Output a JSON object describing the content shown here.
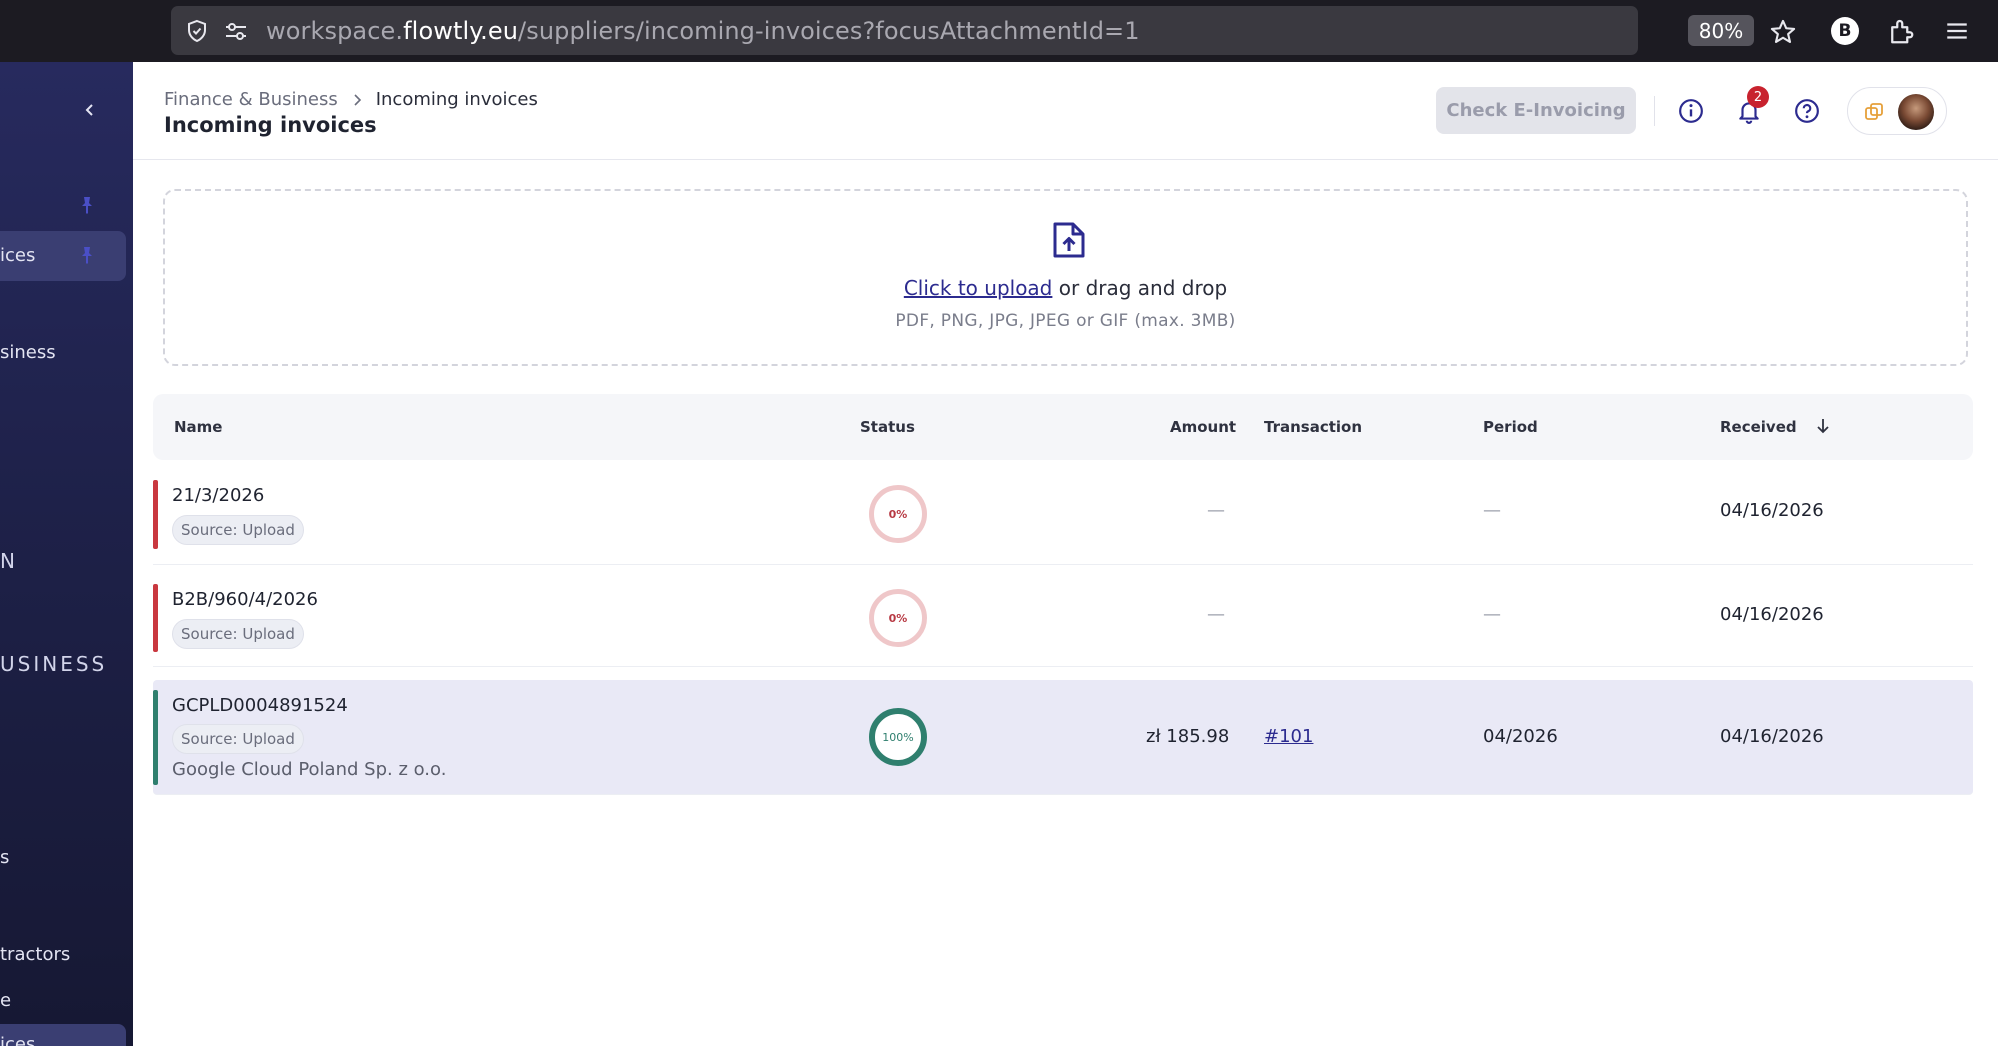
{
  "browser": {
    "url_prefix": "workspace.",
    "url_domain": "flowtly.eu",
    "url_path": "/suppliers/incoming-invoices?focusAttachmentId=1",
    "zoom": "80%",
    "profile_initial": "B"
  },
  "sidebar": {
    "items": [
      {
        "label": "ices"
      },
      {
        "label": "siness"
      },
      {
        "label": "N"
      },
      {
        "label": "USINESS"
      },
      {
        "label": "s"
      },
      {
        "label": "tractors"
      },
      {
        "label": "e"
      },
      {
        "label": "ices"
      }
    ]
  },
  "header": {
    "breadcrumb_parent": "Finance & Business",
    "breadcrumb_current": "Incoming invoices",
    "title": "Incoming invoices",
    "check_button": "Check E-Invoicing",
    "notification_count": "2"
  },
  "upload": {
    "link_text": "Click to upload",
    "rest_text": " or drag and drop",
    "hint": "PDF, PNG, JPG, JPEG or GIF (max. 3MB)"
  },
  "table": {
    "columns": {
      "name": "Name",
      "status": "Status",
      "amount": "Amount",
      "transaction": "Transaction",
      "period": "Period",
      "received": "Received"
    },
    "rows": [
      {
        "name": "21/3/2026",
        "source": "Source: Upload",
        "supplier": "",
        "status": "0%",
        "amount": "—",
        "transaction": "",
        "period": "—",
        "received": "04/16/2026",
        "accent": "#c9383f"
      },
      {
        "name": "B2B/960/4/2026",
        "source": "Source: Upload",
        "supplier": "",
        "status": "0%",
        "amount": "—",
        "transaction": "",
        "period": "—",
        "received": "04/16/2026",
        "accent": "#c9383f"
      },
      {
        "name": "GCPLD0004891524",
        "source": "Source: Upload",
        "supplier": "Google Cloud Poland Sp. z o.o.",
        "status": "100%",
        "amount": "zł 185.98",
        "transaction": "#101",
        "period": "04/2026",
        "received": "04/16/2026",
        "accent": "#2f7f6e"
      }
    ]
  },
  "colors": {
    "accent": "#2c2b8f",
    "sidebar_bg": "#1e2149",
    "selected_row": "#e9e9f6",
    "error": "#c9383f",
    "success": "#2f7f6e"
  }
}
